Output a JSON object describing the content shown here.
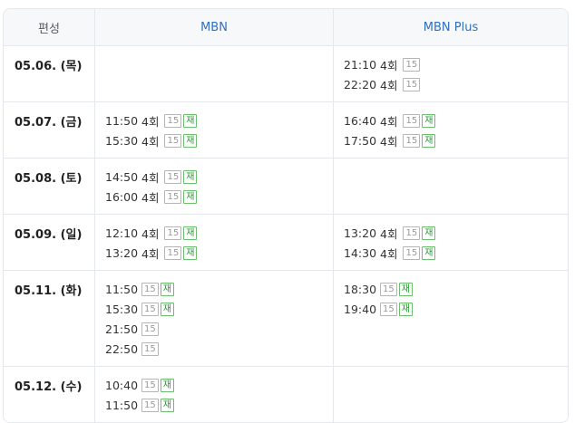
{
  "header": {
    "date_col": "편성",
    "channel1": "MBN",
    "channel2": "MBN Plus"
  },
  "rows": [
    {
      "date": "05.06. (목)",
      "mbn": [],
      "plus": [
        {
          "time": "21:10",
          "ep": "4회",
          "rating": "15",
          "rerun": ""
        },
        {
          "time": "22:20",
          "ep": "4회",
          "rating": "15",
          "rerun": ""
        }
      ]
    },
    {
      "date": "05.07. (금)",
      "mbn": [
        {
          "time": "11:50",
          "ep": "4회",
          "rating": "15",
          "rerun": "재"
        },
        {
          "time": "15:30",
          "ep": "4회",
          "rating": "15",
          "rerun": "재"
        }
      ],
      "plus": [
        {
          "time": "16:40",
          "ep": "4회",
          "rating": "15",
          "rerun": "재"
        },
        {
          "time": "17:50",
          "ep": "4회",
          "rating": "15",
          "rerun": "재"
        }
      ]
    },
    {
      "date": "05.08. (토)",
      "mbn": [
        {
          "time": "14:50",
          "ep": "4회",
          "rating": "15",
          "rerun": "재"
        },
        {
          "time": "16:00",
          "ep": "4회",
          "rating": "15",
          "rerun": "재"
        }
      ],
      "plus": []
    },
    {
      "date": "05.09. (일)",
      "mbn": [
        {
          "time": "12:10",
          "ep": "4회",
          "rating": "15",
          "rerun": "재"
        },
        {
          "time": "13:20",
          "ep": "4회",
          "rating": "15",
          "rerun": "재"
        }
      ],
      "plus": [
        {
          "time": "13:20",
          "ep": "4회",
          "rating": "15",
          "rerun": "재"
        },
        {
          "time": "14:30",
          "ep": "4회",
          "rating": "15",
          "rerun": "재"
        }
      ]
    },
    {
      "date": "05.11. (화)",
      "mbn": [
        {
          "time": "11:50",
          "ep": "",
          "rating": "15",
          "rerun": "재"
        },
        {
          "time": "15:30",
          "ep": "",
          "rating": "15",
          "rerun": "재"
        },
        {
          "time": "21:50",
          "ep": "",
          "rating": "15",
          "rerun": ""
        },
        {
          "time": "22:50",
          "ep": "",
          "rating": "15",
          "rerun": ""
        }
      ],
      "plus": [
        {
          "time": "18:30",
          "ep": "",
          "rating": "15",
          "rerun": "재"
        },
        {
          "time": "19:40",
          "ep": "",
          "rating": "15",
          "rerun": "재"
        }
      ]
    },
    {
      "date": "05.12. (수)",
      "mbn": [
        {
          "time": "10:40",
          "ep": "",
          "rating": "15",
          "rerun": "재"
        },
        {
          "time": "11:50",
          "ep": "",
          "rating": "15",
          "rerun": "재"
        }
      ],
      "plus": []
    }
  ]
}
